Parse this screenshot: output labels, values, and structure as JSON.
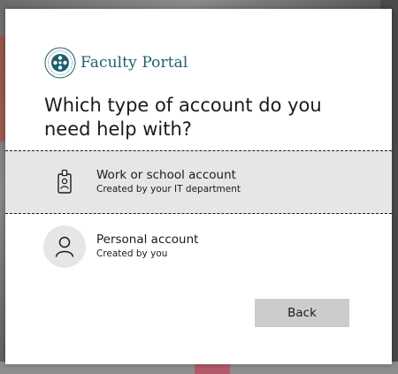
{
  "brand": {
    "name": "Faculty Portal",
    "logo_icon": "university-seal-icon",
    "color": "#1d5f6e"
  },
  "dialog": {
    "question": "Which type of account do you need help with?"
  },
  "options": [
    {
      "title": "Work or school account",
      "subtitle": "Created by your IT department",
      "icon": "id-badge-icon",
      "selected": true
    },
    {
      "title": "Personal account",
      "subtitle": "Created by you",
      "icon": "person-icon",
      "selected": false
    }
  ],
  "actions": {
    "back_label": "Back"
  },
  "colors": {
    "selected_bg": "#e6e6e6",
    "button_bg": "#cccccc",
    "text": "#1b1b1b"
  }
}
